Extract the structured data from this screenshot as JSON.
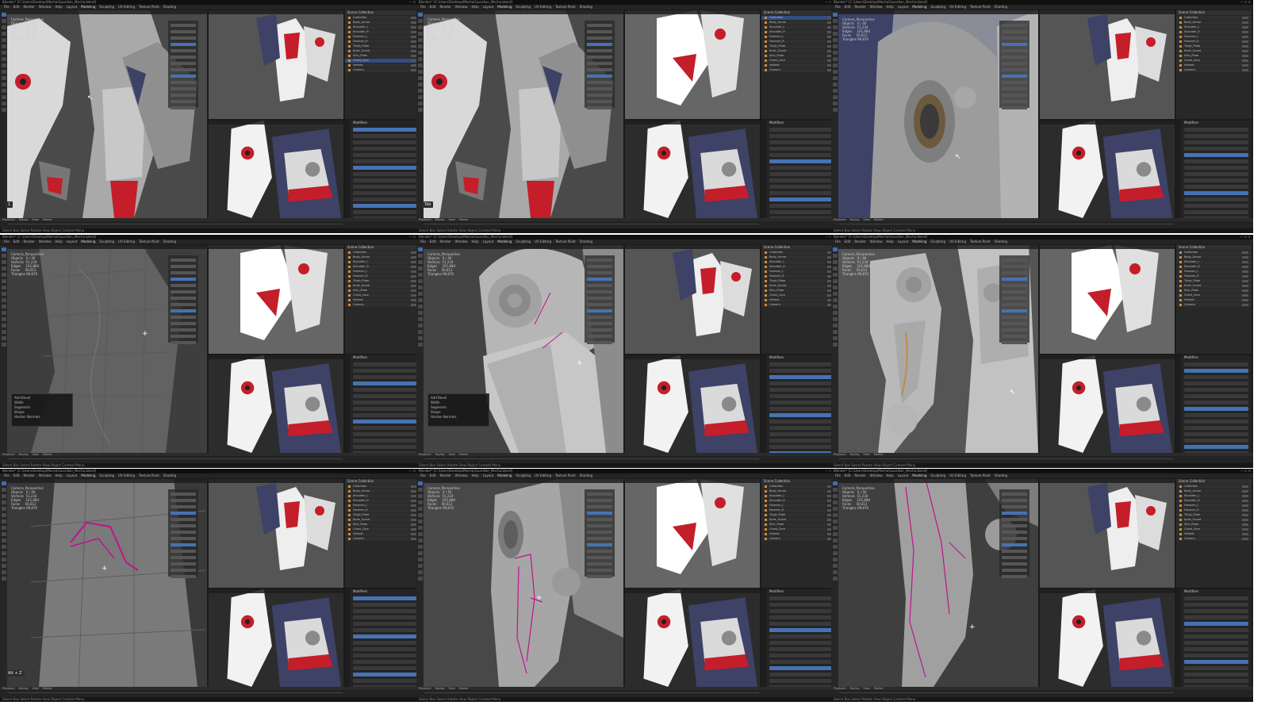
{
  "app": {
    "title": "Blender* [C:\\Users\\Desktop\\Mecha\\Guardian_Mecha.blend]",
    "menus": [
      "File",
      "Edit",
      "Render",
      "Window",
      "Help"
    ],
    "workspaces": [
      "Layout",
      "Modeling",
      "Sculpting",
      "UV Editing",
      "Texture Paint",
      "Shading"
    ],
    "object_name": "Camera_Perspective",
    "stats": [
      "Objects   0 / 40",
      "Vertices  51,234",
      "Edges     101,884",
      "Faces     50,612",
      "Triangles 99,870"
    ],
    "outliner_header": "Scene Collection",
    "outliner_items": [
      "Collection",
      "Body_Armor",
      "Shoulder_L",
      "Shoulder_R",
      "Forearm_L",
      "Forearm_R",
      "Thigh_Plate",
      "Knee_Guard",
      "Shin_Plate",
      "Chest_Core",
      "Helmet",
      "Camera"
    ],
    "properties_header": "Modifiers",
    "timeline": [
      "Playback",
      "Keying",
      "View",
      "Marker"
    ],
    "statusbar": "Select   Box Select   Rotate View   Object Context Menu",
    "popup_lines": [
      "Add Bevel",
      "Width",
      "Segments",
      "Shape",
      "Harden Normals"
    ],
    "colors": {
      "bg": "#1b1b1b",
      "accent": "#4772b3",
      "armor_red": "#c41e2a",
      "armor_blue": "#3d4266",
      "wire": "#c0138f"
    }
  },
  "panels": [
    {
      "id": "p1",
      "scene": "detail",
      "outliner_sel": 9,
      "key": "1",
      "cursor": "↖"
    },
    {
      "id": "p2",
      "scene": "detail",
      "outliner_sel": 0,
      "key": "Tab",
      "cursor": ""
    },
    {
      "id": "p3",
      "scene": "vent",
      "outliner_sel": -1,
      "key": "",
      "cursor": "↖"
    },
    {
      "id": "p4",
      "scene": "sculpt-wire",
      "outliner_sel": -1,
      "key": "",
      "cursor": "+"
    },
    {
      "id": "p5",
      "scene": "shoulder",
      "outliner_sel": -1,
      "key": "",
      "cursor": "+"
    },
    {
      "id": "p6",
      "scene": "arm",
      "outliner_sel": -1,
      "key": "",
      "cursor": "↖"
    },
    {
      "id": "p7",
      "scene": "wire-cut",
      "outliner_sel": -1,
      "key": "Alt + Z",
      "cursor": "+"
    },
    {
      "id": "p8",
      "scene": "forearm",
      "outliner_sel": -1,
      "key": "",
      "cursor": "+"
    },
    {
      "id": "p9",
      "scene": "leg",
      "outliner_sel": -1,
      "key": "",
      "cursor": "+"
    }
  ]
}
